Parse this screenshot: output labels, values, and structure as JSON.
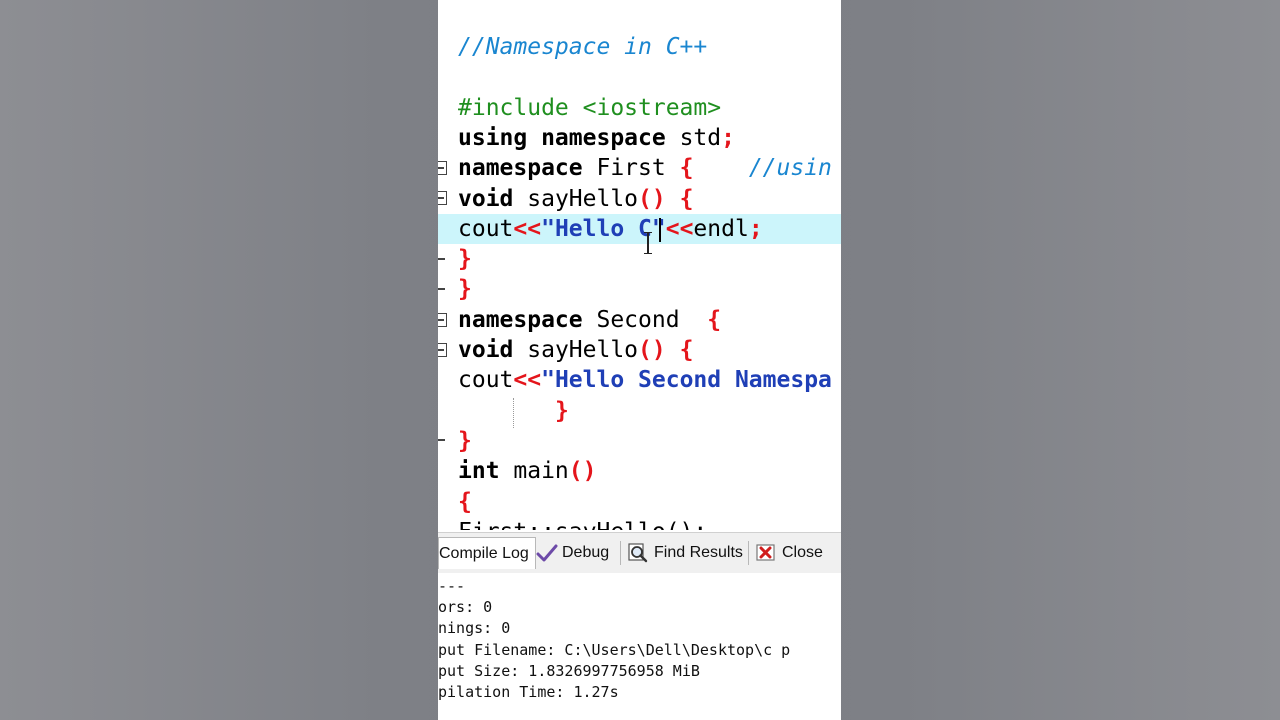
{
  "editor": {
    "lines": [
      {
        "parts": [
          {
            "t": "//Namespace in C++",
            "c": "cm"
          }
        ]
      },
      {
        "parts": []
      },
      {
        "parts": [
          {
            "t": "#include <iostream>",
            "c": "pp"
          }
        ]
      },
      {
        "parts": [
          {
            "t": "using namespace ",
            "c": "kw"
          },
          {
            "t": "std",
            "c": "id"
          },
          {
            "t": ";",
            "c": "sym"
          }
        ]
      },
      {
        "parts": [
          {
            "t": "namespace ",
            "c": "kw"
          },
          {
            "t": "First ",
            "c": "id"
          },
          {
            "t": "{",
            "c": "sym"
          },
          {
            "t": "    //usin",
            "c": "cm"
          }
        ]
      },
      {
        "parts": [
          {
            "t": "void ",
            "c": "kw"
          },
          {
            "t": "sayHello",
            "c": "id"
          },
          {
            "t": "() {",
            "c": "sym"
          }
        ]
      },
      {
        "parts": [
          {
            "t": "cout",
            "c": "id"
          },
          {
            "t": "<<",
            "c": "sym"
          },
          {
            "t": "\"Hello C\"",
            "c": "st"
          },
          {
            "t": "<<",
            "c": "sym"
          },
          {
            "t": "endl",
            "c": "id"
          },
          {
            "t": ";",
            "c": "sym"
          }
        ]
      },
      {
        "parts": [
          {
            "t": "}",
            "c": "sym"
          }
        ]
      },
      {
        "parts": [
          {
            "t": "}",
            "c": "sym"
          }
        ]
      },
      {
        "parts": [
          {
            "t": "namespace ",
            "c": "kw"
          },
          {
            "t": "Second  ",
            "c": "id"
          },
          {
            "t": "{",
            "c": "sym"
          }
        ]
      },
      {
        "parts": [
          {
            "t": "void ",
            "c": "kw"
          },
          {
            "t": "sayHello",
            "c": "id"
          },
          {
            "t": "() {",
            "c": "sym"
          }
        ]
      },
      {
        "parts": [
          {
            "t": "cout",
            "c": "id"
          },
          {
            "t": "<<",
            "c": "sym"
          },
          {
            "t": "\"Hello Second Namespa",
            "c": "st"
          }
        ]
      },
      {
        "parts": [
          {
            "t": "       ",
            "c": "id"
          },
          {
            "t": "}",
            "c": "sym"
          }
        ]
      },
      {
        "parts": [
          {
            "t": "}",
            "c": "sym"
          }
        ]
      },
      {
        "parts": [
          {
            "t": "int ",
            "c": "kw"
          },
          {
            "t": "main",
            "c": "id"
          },
          {
            "t": "()",
            "c": "sym"
          }
        ]
      },
      {
        "parts": [
          {
            "t": "{",
            "c": "sym"
          }
        ]
      },
      {
        "parts": [
          {
            "t": "First::sayHello();",
            "c": "id"
          }
        ]
      }
    ]
  },
  "tabs": {
    "compile_log": "Compile Log",
    "debug": "Debug",
    "find_results": "Find Results",
    "close": "Close"
  },
  "log": {
    "lines": [
      "---",
      "ors: 0",
      "nings: 0",
      "put Filename: C:\\Users\\Dell\\Desktop\\c p",
      "put Size: 1.8326997756958 MiB",
      "pilation Time: 1.27s"
    ]
  },
  "icons": {
    "debug": "checkmark-icon",
    "find_results": "magnifier-icon",
    "close": "close-icon"
  }
}
